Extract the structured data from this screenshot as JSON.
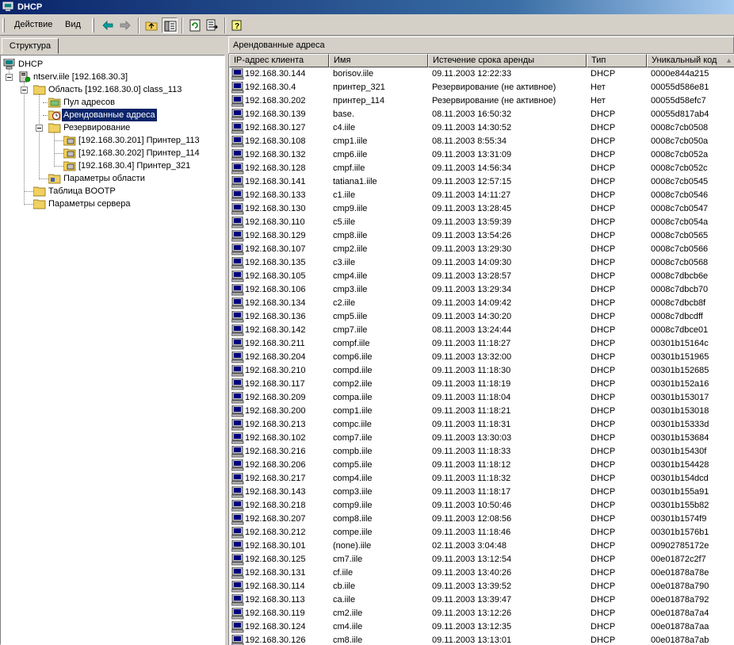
{
  "window": {
    "title": "DHCP",
    "icon": "dhcp-app-icon"
  },
  "toolbar": {
    "menu_action": "Действие",
    "menu_view": "Вид",
    "buttons": [
      "back-arrow-icon",
      "forward-arrow-icon",
      "up-folder-icon",
      "show-hide-tree-icon",
      "refresh-icon",
      "export-list-icon",
      "help-icon"
    ]
  },
  "left": {
    "tab_label": "Структура",
    "tree": {
      "root": "DHCP",
      "server": "ntserv.iile [192.168.30.3]",
      "scope": "Область [192.168.30.0] class_113",
      "pool": "Пул адресов",
      "leases": "Арендованные адреса",
      "reservations": "Резервирование",
      "res1": "[192.168.30.201] Принтер_113",
      "res2": "[192.168.30.202] Принтер_114",
      "res3": "[192.168.30.4] Принтер_321",
      "scope_options": "Параметры области",
      "bootp": "Таблица BOOTP",
      "server_options": "Параметры сервера"
    }
  },
  "right": {
    "title": "Арендованные адреса",
    "columns": [
      "IP-адрес клиента",
      "Имя",
      "Истечение срока аренды",
      "Тип",
      "Уникальный код"
    ],
    "rows": [
      [
        "192.168.30.144",
        "borisov.iile",
        "09.11.2003 12:22:33",
        "DHCP",
        "0000e844a215"
      ],
      [
        "192.168.30.4",
        "принтер_321",
        "Резервирование (не активное)",
        "Нет",
        "00055d586e81"
      ],
      [
        "192.168.30.202",
        "принтер_114",
        "Резервирование (не активное)",
        "Нет",
        "00055d58efc7"
      ],
      [
        "192.168.30.139",
        "base.",
        "08.11.2003 16:50:32",
        "DHCP",
        "00055d817ab4"
      ],
      [
        "192.168.30.127",
        "c4.iile",
        "09.11.2003 14:30:52",
        "DHCP",
        "0008c7cb0508"
      ],
      [
        "192.168.30.108",
        "cmp1.iile",
        "08.11.2003 8:55:34",
        "DHCP",
        "0008c7cb050a"
      ],
      [
        "192.168.30.132",
        "cmp6.iile",
        "09.11.2003 13:31:09",
        "DHCP",
        "0008c7cb052a"
      ],
      [
        "192.168.30.128",
        "cmpf.iile",
        "09.11.2003 14:56:34",
        "DHCP",
        "0008c7cb052c"
      ],
      [
        "192.168.30.141",
        "tatiana1.iile",
        "09.11.2003 12:57:15",
        "DHCP",
        "0008c7cb0545"
      ],
      [
        "192.168.30.133",
        "c1.iile",
        "09.11.2003 14:11:27",
        "DHCP",
        "0008c7cb0546"
      ],
      [
        "192.168.30.130",
        "cmp9.iile",
        "09.11.2003 13:28:45",
        "DHCP",
        "0008c7cb0547"
      ],
      [
        "192.168.30.110",
        "c5.iile",
        "09.11.2003 13:59:39",
        "DHCP",
        "0008c7cb054a"
      ],
      [
        "192.168.30.129",
        "cmp8.iile",
        "09.11.2003 13:54:26",
        "DHCP",
        "0008c7cb0565"
      ],
      [
        "192.168.30.107",
        "cmp2.iile",
        "09.11.2003 13:29:30",
        "DHCP",
        "0008c7cb0566"
      ],
      [
        "192.168.30.135",
        "c3.iile",
        "09.11.2003 14:09:30",
        "DHCP",
        "0008c7cb0568"
      ],
      [
        "192.168.30.105",
        "cmp4.iile",
        "09.11.2003 13:28:57",
        "DHCP",
        "0008c7dbcb6e"
      ],
      [
        "192.168.30.106",
        "cmp3.iile",
        "09.11.2003 13:29:34",
        "DHCP",
        "0008c7dbcb70"
      ],
      [
        "192.168.30.134",
        "c2.iile",
        "09.11.2003 14:09:42",
        "DHCP",
        "0008c7dbcb8f"
      ],
      [
        "192.168.30.136",
        "cmp5.iile",
        "09.11.2003 14:30:20",
        "DHCP",
        "0008c7dbcdff"
      ],
      [
        "192.168.30.142",
        "cmp7.iile",
        "08.11.2003 13:24:44",
        "DHCP",
        "0008c7dbce01"
      ],
      [
        "192.168.30.211",
        "compf.iile",
        "09.11.2003 11:18:27",
        "DHCP",
        "00301b15164c"
      ],
      [
        "192.168.30.204",
        "comp6.iile",
        "09.11.2003 13:32:00",
        "DHCP",
        "00301b151965"
      ],
      [
        "192.168.30.210",
        "compd.iile",
        "09.11.2003 11:18:30",
        "DHCP",
        "00301b152685"
      ],
      [
        "192.168.30.117",
        "comp2.iile",
        "09.11.2003 11:18:19",
        "DHCP",
        "00301b152a16"
      ],
      [
        "192.168.30.209",
        "compa.iile",
        "09.11.2003 11:18:04",
        "DHCP",
        "00301b153017"
      ],
      [
        "192.168.30.200",
        "comp1.iile",
        "09.11.2003 11:18:21",
        "DHCP",
        "00301b153018"
      ],
      [
        "192.168.30.213",
        "compc.iile",
        "09.11.2003 11:18:31",
        "DHCP",
        "00301b15333d"
      ],
      [
        "192.168.30.102",
        "comp7.iile",
        "09.11.2003 13:30:03",
        "DHCP",
        "00301b153684"
      ],
      [
        "192.168.30.216",
        "compb.iile",
        "09.11.2003 11:18:33",
        "DHCP",
        "00301b15430f"
      ],
      [
        "192.168.30.206",
        "comp5.iile",
        "09.11.2003 11:18:12",
        "DHCP",
        "00301b154428"
      ],
      [
        "192.168.30.217",
        "comp4.iile",
        "09.11.2003 11:18:32",
        "DHCP",
        "00301b154dcd"
      ],
      [
        "192.168.30.143",
        "comp3.iile",
        "09.11.2003 11:18:17",
        "DHCP",
        "00301b155a91"
      ],
      [
        "192.168.30.218",
        "comp9.iile",
        "09.11.2003 10:50:46",
        "DHCP",
        "00301b155b82"
      ],
      [
        "192.168.30.207",
        "comp8.iile",
        "09.11.2003 12:08:56",
        "DHCP",
        "00301b1574f9"
      ],
      [
        "192.168.30.212",
        "compe.iile",
        "09.11.2003 11:18:46",
        "DHCP",
        "00301b1576b1"
      ],
      [
        "192.168.30.101",
        "(none).iile",
        "02.11.2003 3:04:48",
        "DHCP",
        "00902785172e"
      ],
      [
        "192.168.30.125",
        "cm7.iile",
        "09.11.2003 13:12:54",
        "DHCP",
        "00e01872c2f7"
      ],
      [
        "192.168.30.131",
        "cf.iile",
        "09.11.2003 13:40:26",
        "DHCP",
        "00e01878a78e"
      ],
      [
        "192.168.30.114",
        "cb.iile",
        "09.11.2003 13:39:52",
        "DHCP",
        "00e01878a790"
      ],
      [
        "192.168.30.113",
        "ca.iile",
        "09.11.2003 13:39:47",
        "DHCP",
        "00e01878a792"
      ],
      [
        "192.168.30.119",
        "cm2.iile",
        "09.11.2003 13:12:26",
        "DHCP",
        "00e01878a7a4"
      ],
      [
        "192.168.30.124",
        "cm4.iile",
        "09.11.2003 13:12:35",
        "DHCP",
        "00e01878a7aa"
      ],
      [
        "192.168.30.126",
        "cm8.iile",
        "09.11.2003 13:13:01",
        "DHCP",
        "00e01878a7ab"
      ]
    ]
  },
  "colors": {
    "titlebar": "#0a246a",
    "selection": "#0a246a",
    "chrome": "#d4d0c8"
  }
}
